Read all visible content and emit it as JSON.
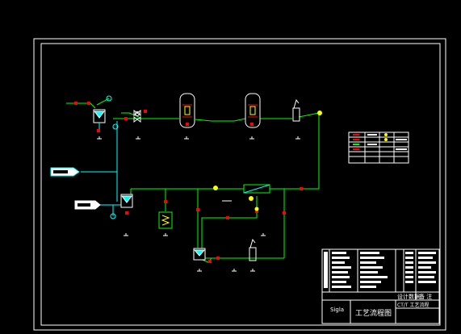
{
  "title_block": {
    "drawing_title": "工艺流程图",
    "row_label_1": "设计数据",
    "row_label_2": "备 注",
    "project_line": "CT/T 工艺流程",
    "logo_text": "Sigla"
  },
  "colors": {
    "background": "#000000",
    "frame": "#ffffff",
    "process_line": "#00ff00",
    "feed_line": "#00ffff",
    "valve": "#ff0000",
    "instrument": "#ffff00",
    "vessel": "#ffffff"
  },
  "legend": {
    "rows": 6
  }
}
